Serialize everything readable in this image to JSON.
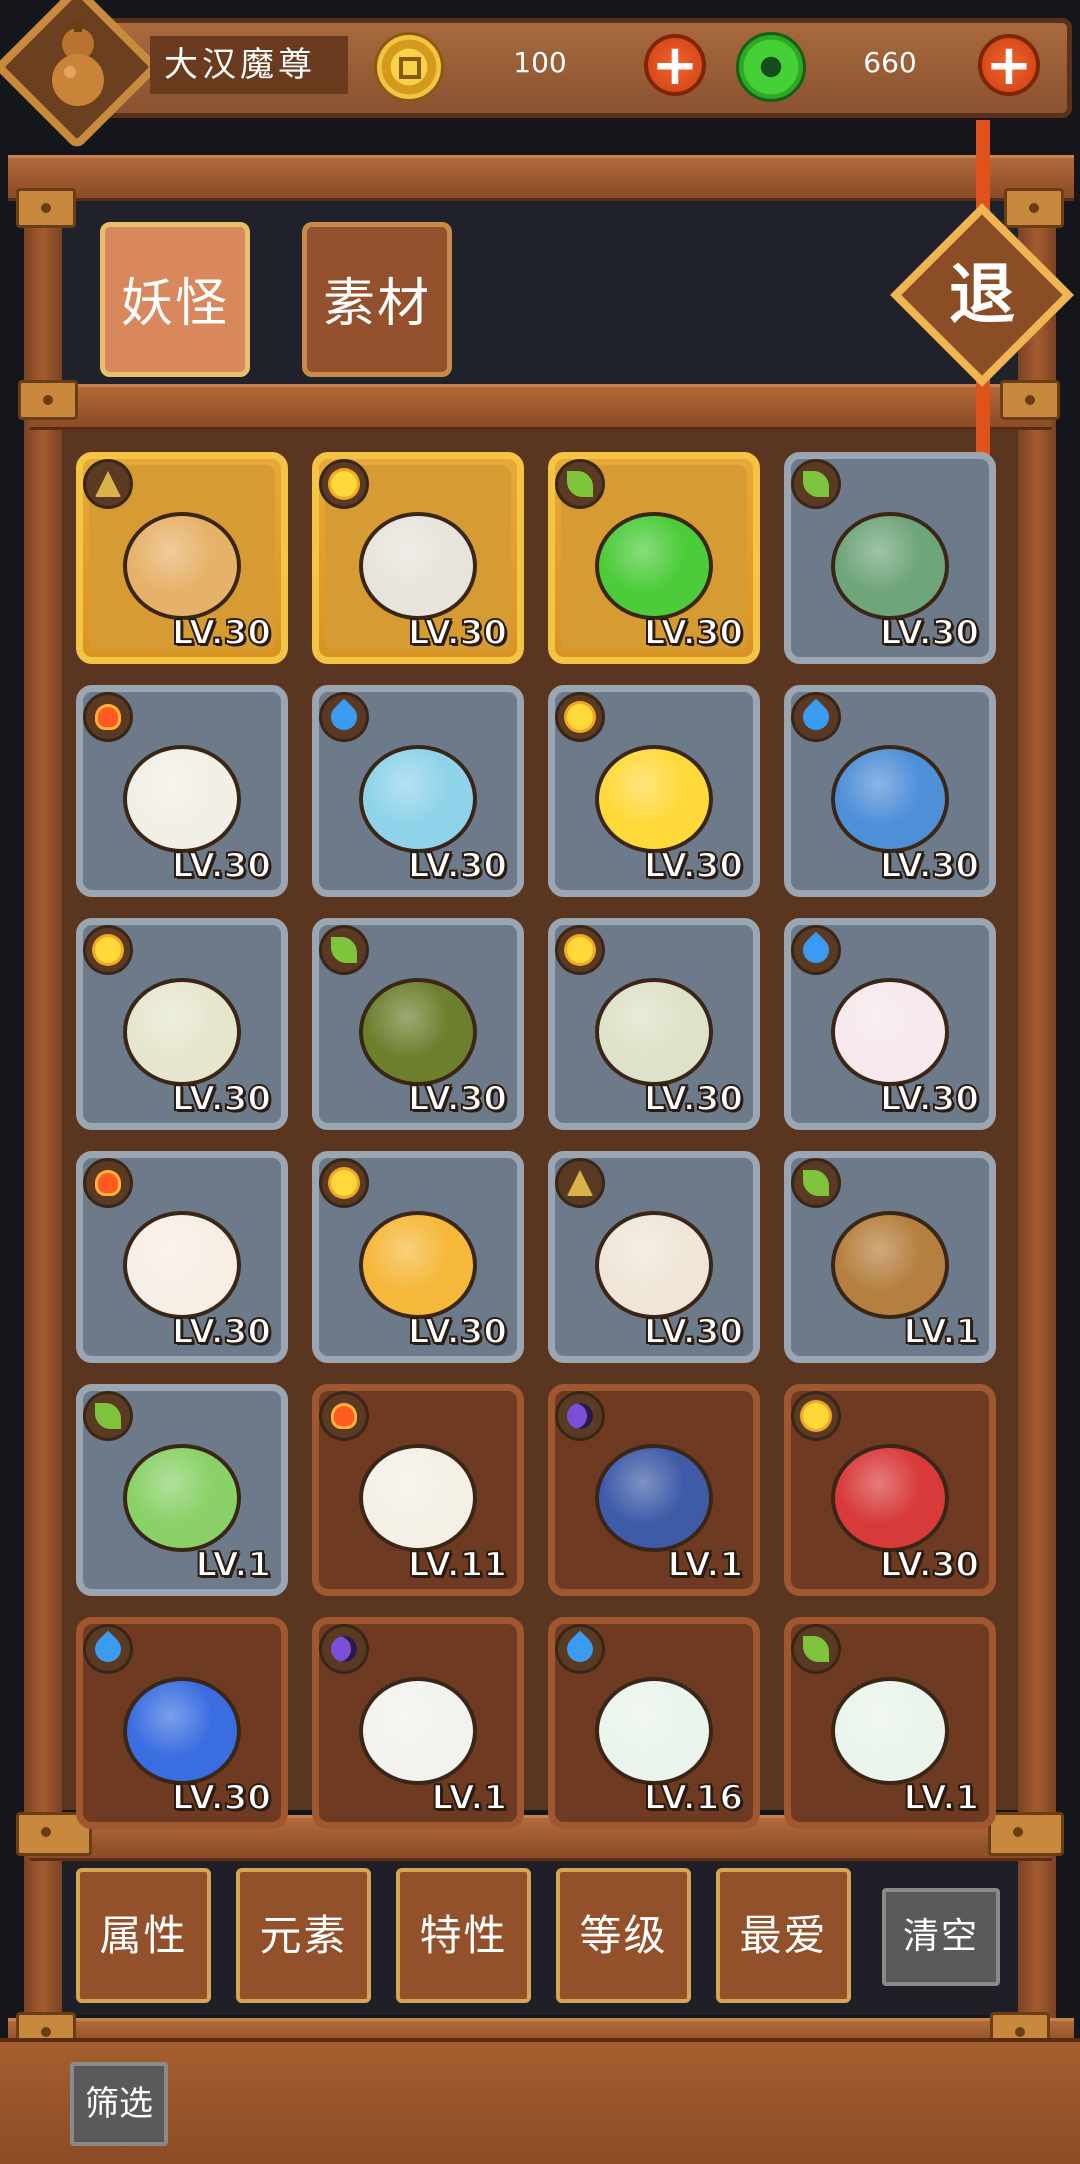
{
  "header": {
    "player_name": "大汉魔尊",
    "gold_amount": "100",
    "jade_amount": "660"
  },
  "tabs": [
    {
      "label": "妖怪",
      "active": true
    },
    {
      "label": "素材",
      "active": false
    }
  ],
  "exit_label": "退",
  "monsters": [
    {
      "level": "LV.30",
      "element": "mountain",
      "rarity": "gold",
      "color": "#e6b26a"
    },
    {
      "level": "LV.30",
      "element": "sun",
      "rarity": "gold",
      "color": "#e8e4dc"
    },
    {
      "level": "LV.30",
      "element": "leaf",
      "rarity": "gold",
      "color": "#4ccc3a"
    },
    {
      "level": "LV.30",
      "element": "leaf",
      "rarity": "silver",
      "color": "#6fa57a"
    },
    {
      "level": "LV.30",
      "element": "fire",
      "rarity": "silver",
      "color": "#f2efe6"
    },
    {
      "level": "LV.30",
      "element": "water",
      "rarity": "silver",
      "color": "#8fd3ea"
    },
    {
      "level": "LV.30",
      "element": "sun",
      "rarity": "silver",
      "color": "#ffd93a"
    },
    {
      "level": "LV.30",
      "element": "water",
      "rarity": "silver",
      "color": "#4f8fd8"
    },
    {
      "level": "LV.30",
      "element": "sun",
      "rarity": "silver",
      "color": "#e6e6cf"
    },
    {
      "level": "LV.30",
      "element": "leaf",
      "rarity": "silver",
      "color": "#6e7f2e"
    },
    {
      "level": "LV.30",
      "element": "sun",
      "rarity": "silver",
      "color": "#dfe1c8"
    },
    {
      "level": "LV.30",
      "element": "water",
      "rarity": "silver",
      "color": "#f6e8ec"
    },
    {
      "level": "LV.30",
      "element": "fire",
      "rarity": "silver",
      "color": "#f7eee6"
    },
    {
      "level": "LV.30",
      "element": "sun",
      "rarity": "silver",
      "color": "#f5b83a"
    },
    {
      "level": "LV.30",
      "element": "mountain",
      "rarity": "silver",
      "color": "#efe6d8"
    },
    {
      "level": "LV.1",
      "element": "leaf",
      "rarity": "silver",
      "color": "#b5803f"
    },
    {
      "level": "LV.1",
      "element": "leaf",
      "rarity": "silver",
      "color": "#8ad168"
    },
    {
      "level": "LV.11",
      "element": "fire",
      "rarity": "bronze",
      "color": "#f5f0e6"
    },
    {
      "level": "LV.1",
      "element": "moon",
      "rarity": "bronze",
      "color": "#3e5ba8"
    },
    {
      "level": "LV.30",
      "element": "sun",
      "rarity": "bronze",
      "color": "#d83a3a"
    },
    {
      "level": "LV.30",
      "element": "water",
      "rarity": "bronze",
      "color": "#3a6ee0"
    },
    {
      "level": "LV.1",
      "element": "moon",
      "rarity": "bronze",
      "color": "#f2f2ee"
    },
    {
      "level": "LV.16",
      "element": "water",
      "rarity": "bronze",
      "color": "#eaf4ec"
    },
    {
      "level": "LV.1",
      "element": "leaf",
      "rarity": "bronze",
      "color": "#eaf4ec"
    }
  ],
  "filters": [
    {
      "label": "属性"
    },
    {
      "label": "元素"
    },
    {
      "label": "特性"
    },
    {
      "label": "等级"
    },
    {
      "label": "最爱"
    }
  ],
  "clear_label": "清空",
  "screen_label": "筛选"
}
